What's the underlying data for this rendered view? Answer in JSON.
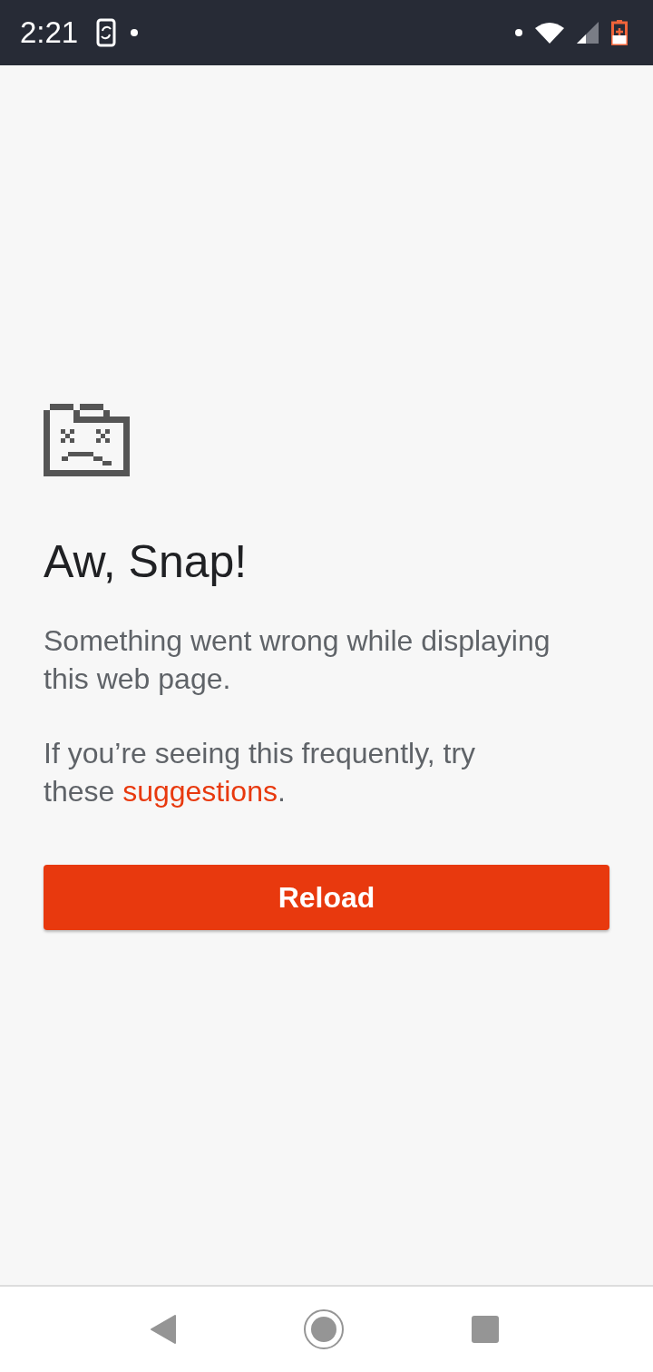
{
  "status_bar": {
    "time": "2:21"
  },
  "error": {
    "title": "Aw, Snap!",
    "message": "Something went wrong while displaying this web page.",
    "hint_before": "If you’re seeing this frequently, try these ",
    "hint_link": "suggestions",
    "hint_after": "."
  },
  "buttons": [
    {
      "label": "Reload"
    }
  ]
}
